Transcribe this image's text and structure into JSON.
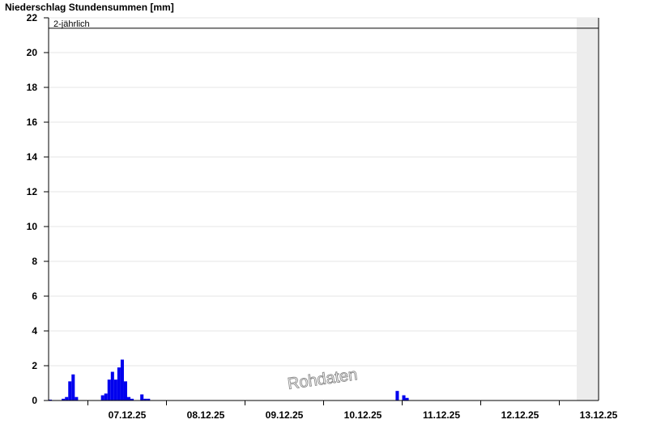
{
  "chart_data": {
    "type": "bar",
    "title": "Niederschlag Stundensummen [mm]",
    "xlabel": "",
    "ylabel": "",
    "ylim": [
      0,
      22
    ],
    "yticks": [
      0,
      2,
      4,
      6,
      8,
      10,
      12,
      14,
      16,
      18,
      20,
      22
    ],
    "x_start": "06.12.25 12:00",
    "x_end": "13.12.25 12:00",
    "x_tick_labels": [
      "07.12.25",
      "08.12.25",
      "09.12.25",
      "10.12.25",
      "11.12.25",
      "12.12.25",
      "13.12.25"
    ],
    "grid": true,
    "reference_line": {
      "label": "2-jährlich",
      "value": 21.4
    },
    "watermark": "Rohdaten",
    "series": [
      {
        "color": "#0000ee",
        "points": [
          {
            "t": "06.12.25 13:00",
            "v": 0.05
          },
          {
            "t": "06.12.25 17:00",
            "v": 0.1
          },
          {
            "t": "06.12.25 18:00",
            "v": 0.2
          },
          {
            "t": "06.12.25 19:00",
            "v": 1.1
          },
          {
            "t": "06.12.25 20:00",
            "v": 1.5
          },
          {
            "t": "06.12.25 21:00",
            "v": 0.2
          },
          {
            "t": "07.12.25 05:00",
            "v": 0.3
          },
          {
            "t": "07.12.25 06:00",
            "v": 0.4
          },
          {
            "t": "07.12.25 07:00",
            "v": 1.2
          },
          {
            "t": "07.12.25 08:00",
            "v": 1.65
          },
          {
            "t": "07.12.25 09:00",
            "v": 1.2
          },
          {
            "t": "07.12.25 10:00",
            "v": 1.9
          },
          {
            "t": "07.12.25 11:00",
            "v": 2.35
          },
          {
            "t": "07.12.25 12:00",
            "v": 1.1
          },
          {
            "t": "07.12.25 13:00",
            "v": 0.2
          },
          {
            "t": "07.12.25 14:00",
            "v": 0.1
          },
          {
            "t": "07.12.25 17:00",
            "v": 0.35
          },
          {
            "t": "07.12.25 18:00",
            "v": 0.1
          },
          {
            "t": "07.12.25 19:00",
            "v": 0.1
          },
          {
            "t": "10.12.25 23:00",
            "v": 0.55
          },
          {
            "t": "11.12.25 01:00",
            "v": 0.3
          },
          {
            "t": "11.12.25 02:00",
            "v": 0.15
          }
        ]
      }
    ]
  }
}
